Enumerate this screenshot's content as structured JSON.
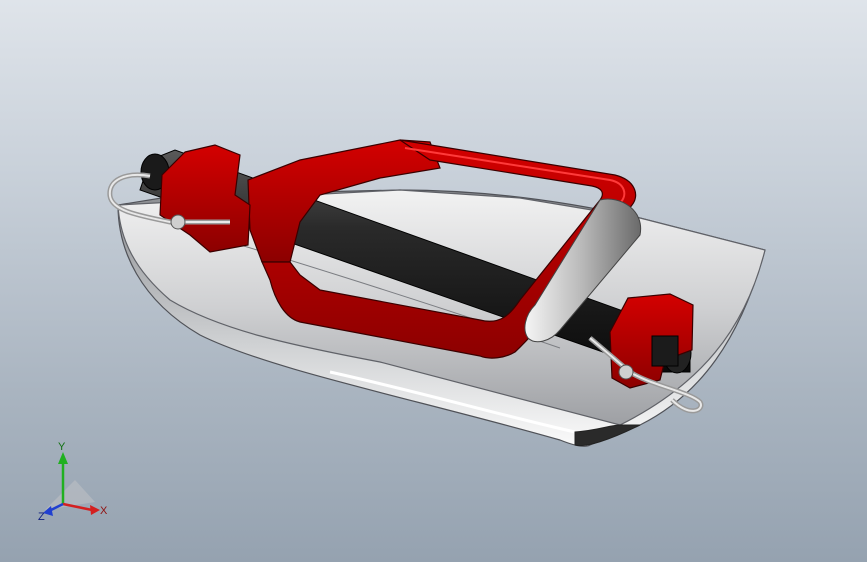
{
  "triad": {
    "x_label": "X",
    "y_label": "Y",
    "z_label": "Z",
    "x_color": "#d42020",
    "y_color": "#20b020",
    "z_color": "#2040d0"
  },
  "model": {
    "frame_color": "#c00000",
    "shaft_color": "#1e1e1e",
    "pad_color": "#d8d8d8",
    "pin_color": "#c8c8c8"
  }
}
